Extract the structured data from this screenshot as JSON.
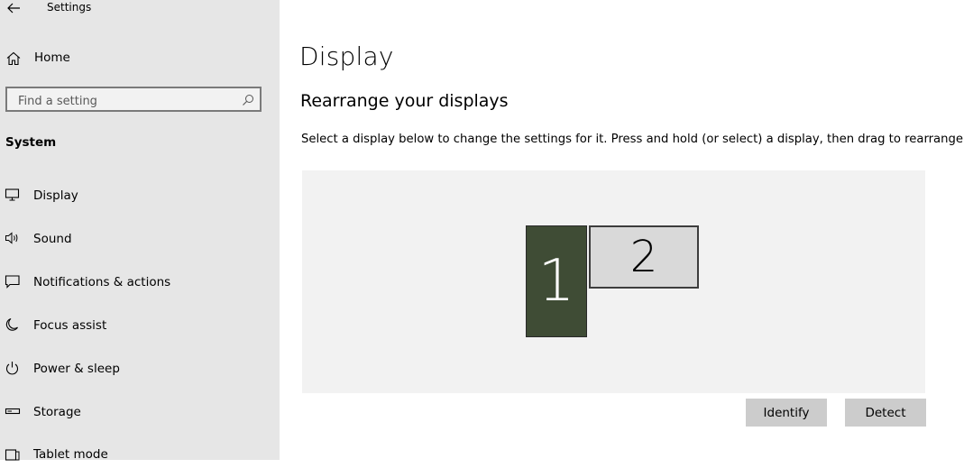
{
  "window": {
    "title": "Settings"
  },
  "sidebar": {
    "home_label": "Home",
    "search": {
      "placeholder": "Find a setting",
      "value": ""
    },
    "section_label": "System",
    "items": [
      {
        "label": "Display",
        "icon": "monitor-icon"
      },
      {
        "label": "Sound",
        "icon": "speaker-icon"
      },
      {
        "label": "Notifications & actions",
        "icon": "notification-icon"
      },
      {
        "label": "Focus assist",
        "icon": "moon-icon"
      },
      {
        "label": "Power & sleep",
        "icon": "power-icon"
      },
      {
        "label": "Storage",
        "icon": "storage-icon"
      },
      {
        "label": "Tablet mode",
        "icon": "tablet-icon"
      }
    ]
  },
  "main": {
    "title": "Display",
    "subtitle": "Rearrange your displays",
    "description": "Select a display below to change the settings for it. Press and hold (or select) a display, then drag to rearrange it.",
    "displays": [
      {
        "number": "1",
        "selected": true,
        "color": "#3f4c35"
      },
      {
        "number": "2",
        "selected": false,
        "color": "#d9d9d9"
      }
    ],
    "identify_label": "Identify",
    "detect_label": "Detect"
  },
  "colors": {
    "sidebar_bg": "#e6e6e6",
    "arrange_bg": "#f2f2f2",
    "button_bg": "#cccccc",
    "accent_selected": "#3f4c35"
  }
}
